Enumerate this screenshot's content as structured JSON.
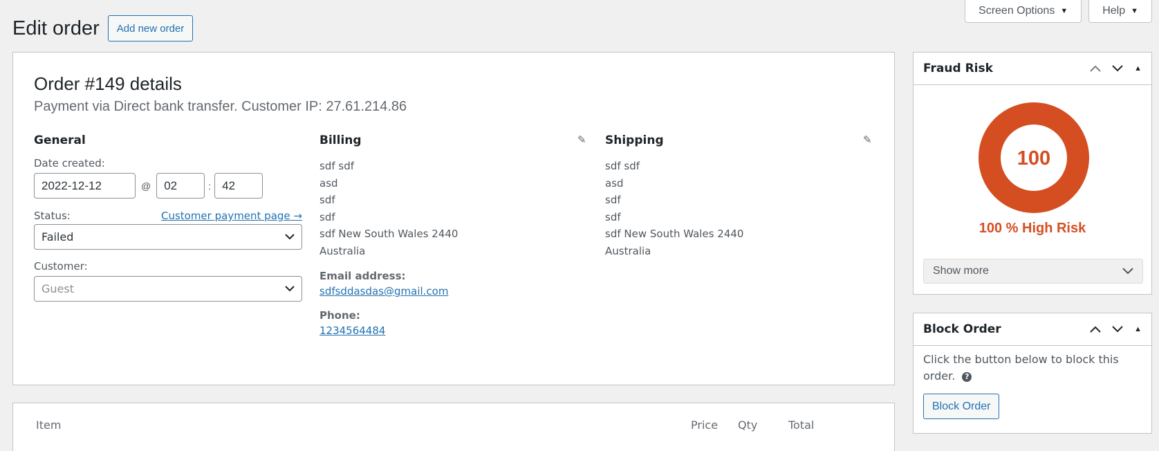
{
  "screen_meta": {
    "screen_options_label": "Screen Options",
    "help_label": "Help"
  },
  "page": {
    "title": "Edit order",
    "add_new_label": "Add new order"
  },
  "order": {
    "title": "Order #149 details",
    "subtitle": "Payment via Direct bank transfer. Customer IP: 27.61.214.86",
    "general": {
      "heading": "General",
      "date_label": "Date created:",
      "date_value": "2022-12-12",
      "at_sign": "@",
      "hour": "02",
      "colon": ":",
      "minute": "42",
      "status_label": "Status:",
      "customer_payment_link": "Customer payment page →",
      "status_value": "Failed",
      "customer_label": "Customer:",
      "customer_value": "Guest"
    },
    "billing": {
      "heading": "Billing",
      "lines": [
        "sdf sdf",
        "asd",
        "sdf",
        "sdf",
        "sdf New South Wales 2440",
        "Australia"
      ],
      "email_label": "Email address:",
      "email": "sdfsddasdas@gmail.com",
      "phone_label": "Phone:",
      "phone": "1234564484"
    },
    "shipping": {
      "heading": "Shipping",
      "lines": [
        "sdf sdf",
        "asd",
        "sdf",
        "sdf",
        "sdf New South Wales 2440",
        "Australia"
      ]
    }
  },
  "items": {
    "columns": [
      "Item",
      "Price",
      "Qty",
      "Total"
    ]
  },
  "fraud_risk": {
    "title": "Fraud Risk",
    "score": "100",
    "score_fraction": 1.0,
    "label": "100 % High Risk",
    "show_more_label": "Show more",
    "color": "#d54e21"
  },
  "block_order": {
    "title": "Block Order",
    "description": "Click the button below to block this order.",
    "help_icon_glyph": "?",
    "button_label": "Block Order"
  },
  "icons": {
    "caret_down": "▼",
    "chevron_up": "⌃",
    "chevron_down": "⌄",
    "toggle_up": "▲",
    "pencil": "✎"
  }
}
